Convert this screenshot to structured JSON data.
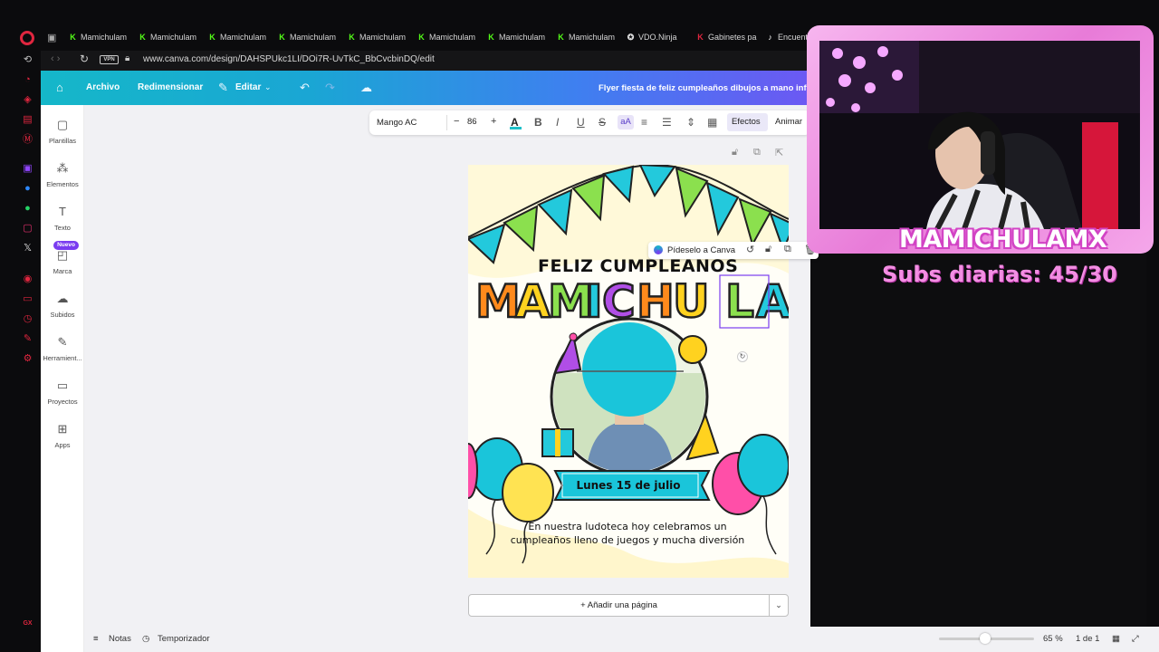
{
  "browser": {
    "tabs": [
      {
        "label": "Mamichulam",
        "icon": "kick-icon"
      },
      {
        "label": "Mamichulam",
        "icon": "kick-icon"
      },
      {
        "label": "Mamichulam",
        "icon": "kick-icon"
      },
      {
        "label": "Mamichulam",
        "icon": "kick-icon"
      },
      {
        "label": "Mamichulam",
        "icon": "kick-icon"
      },
      {
        "label": "Mamichulam",
        "icon": "kick-icon"
      },
      {
        "label": "Mamichulam",
        "icon": "kick-icon"
      },
      {
        "label": "Mamichulam",
        "icon": "kick-icon"
      },
      {
        "label": "VDO.Ninja",
        "icon": "vdo-ninja-icon"
      },
      {
        "label": "Gabinetes pa",
        "icon": "k-red-icon"
      },
      {
        "label": "Encuentra",
        "icon": "tiktok-icon"
      }
    ],
    "vpn_label": "VPN",
    "url": "www.canva.com/design/DAHSPUkc1LI/DOi7R-UvTkC_BbCvcbinDQ/edit",
    "accent": "#e0263f"
  },
  "canva": {
    "header": {
      "archivo": "Archivo",
      "redimensionar": "Redimensionar",
      "editar": "Editar",
      "doc_title": "Flyer fiesta de feliz cumpleaños dibujos a mano infa"
    },
    "sidebar": {
      "items": [
        {
          "label": "Plantillas",
          "icon": "templates-icon"
        },
        {
          "label": "Elementos",
          "icon": "elements-icon"
        },
        {
          "label": "Texto",
          "icon": "text-icon"
        },
        {
          "label": "Marca",
          "icon": "brand-icon"
        },
        {
          "label": "Subidos",
          "icon": "upload-icon"
        },
        {
          "label": "Herramient...",
          "icon": "tools-icon"
        },
        {
          "label": "Proyectos",
          "icon": "folder-icon"
        },
        {
          "label": "Apps",
          "icon": "apps-icon"
        }
      ],
      "badge_new": "Nuevo"
    },
    "toolbar": {
      "font": "Mango AC",
      "size": "86",
      "minus": "−",
      "plus": "+",
      "case_label": "aA",
      "efectos": "Efectos",
      "animar": "Animar"
    },
    "design": {
      "feliz": "FELIZ CUMPLEAÑOS",
      "name": "MAMICHU LA",
      "date": "Lunes 15 de julio",
      "line1": "En nuestra ludoteca hoy celebramos un",
      "line2": "cumpleaños lleno de juegos y mucha diversión"
    },
    "ask_canva": "Pídeselo a Canva",
    "add_page": "+ Añadir una página",
    "footer": {
      "notas": "Notas",
      "temporizador": "Temporizador",
      "zoom": "65 %",
      "pages": "1 de 1",
      "zoom_level_percent": 65
    }
  },
  "overlay": {
    "name": "MAMICHULAMX",
    "subs": "Subs diarias: 45/30"
  }
}
